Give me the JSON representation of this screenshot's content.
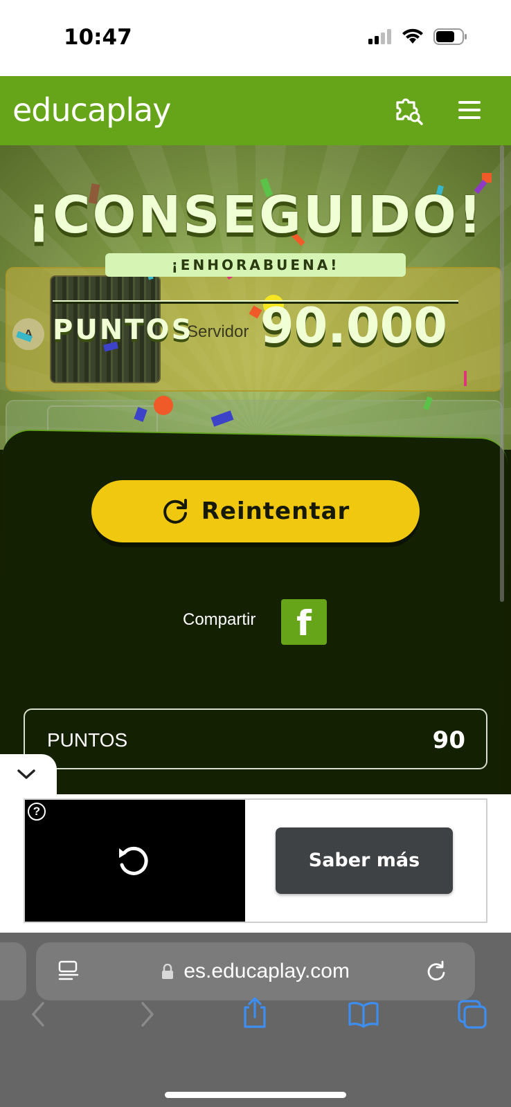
{
  "status_bar": {
    "time": "10:47"
  },
  "header": {
    "logo": "educaplay"
  },
  "game": {
    "title": "¡CONSEGUIDO!",
    "subtitle": "¡ENHORABUENA!",
    "score_label": "PUNTOS",
    "score_value": "90.000",
    "answer": {
      "badge": "A",
      "text": "Servidor"
    },
    "retry_label": "Reintentar",
    "share_label": "Compartir",
    "stats": [
      {
        "label": "PUNTOS",
        "value": "90"
      }
    ]
  },
  "ad": {
    "help": "?",
    "cta": "Saber más"
  },
  "browser": {
    "url": "es.educaplay.com"
  },
  "colors": {
    "brand_green": "#66a51a",
    "button_yellow": "#f0c810",
    "panel_dark": "#142002"
  }
}
